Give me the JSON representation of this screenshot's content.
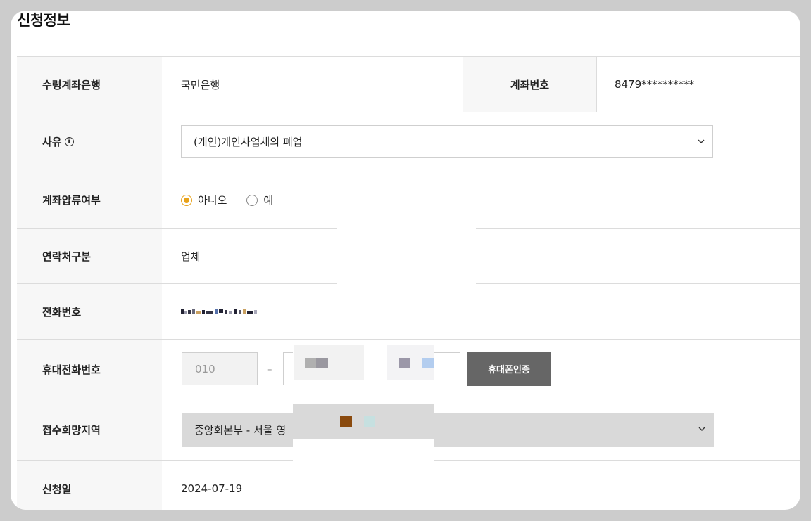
{
  "section_title": "신청정보",
  "rows": {
    "bank": {
      "label": "수령계좌은행",
      "value": "국민은행",
      "account_label": "계좌번호",
      "account_value": "8479**********"
    },
    "reason": {
      "label": "사유",
      "info_icon": "info-circle-icon",
      "selected": "(개인)개인사업체의 폐업"
    },
    "seizure": {
      "label": "계좌압류여부",
      "option_no": "아니오",
      "option_yes": "예",
      "selected": "아니오"
    },
    "contact_type": {
      "label": "연락처구분",
      "value": "업체"
    },
    "phone": {
      "label": "전화번호"
    },
    "mobile": {
      "label": "휴대전화번호",
      "prefix": "010",
      "separator": "–",
      "verify_button": "휴대폰인증"
    },
    "region": {
      "label": "접수희망지역",
      "selected": "중앙회본부 - 서울 영"
    },
    "date": {
      "label": "신청일",
      "value": "2024-07-19"
    }
  },
  "colors": {
    "accent": "#e8a21a",
    "button_bg": "#666666",
    "header_bg": "#f7f7f7"
  }
}
